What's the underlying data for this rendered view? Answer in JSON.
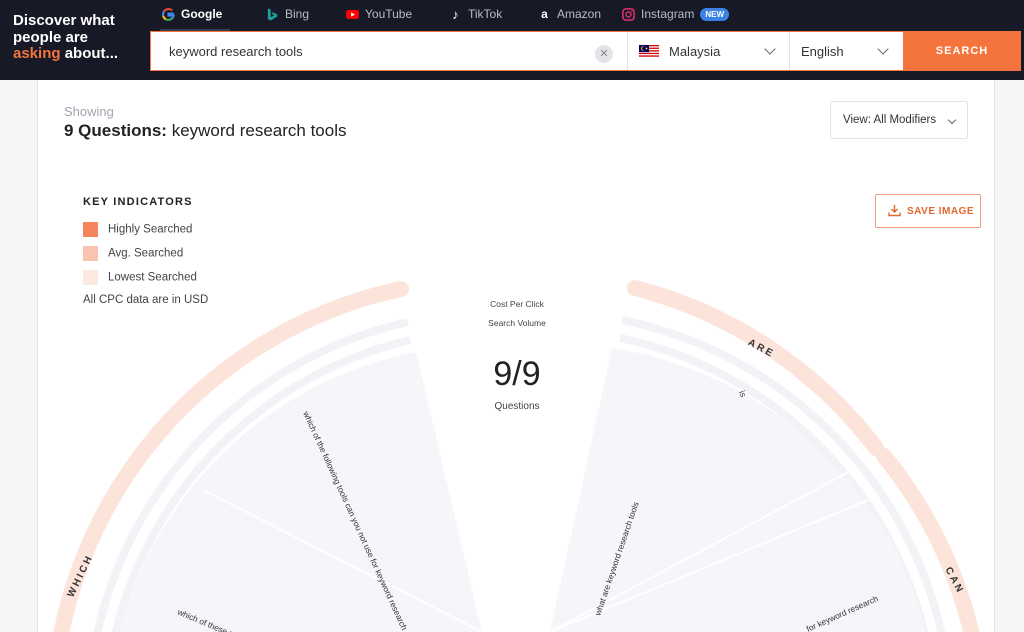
{
  "header": {
    "tagline_1": "Discover what",
    "tagline_2": "people are",
    "tagline_accent": "asking",
    "tagline_3": " about...",
    "engines": [
      {
        "label": "Google",
        "icon": "google-icon",
        "active": true
      },
      {
        "label": "Bing",
        "icon": "bing-icon"
      },
      {
        "label": "YouTube",
        "icon": "youtube-icon"
      },
      {
        "label": "TikTok",
        "icon": "tiktok-icon"
      },
      {
        "label": "Amazon",
        "icon": "amazon-icon"
      },
      {
        "label": "Instagram",
        "icon": "instagram-icon",
        "badge": "NEW"
      }
    ]
  },
  "search": {
    "value": "keyword research tools",
    "clear_icon": "close-icon",
    "country": "Malaysia",
    "country_icon": "malaysia-flag-icon",
    "language": "English",
    "button_label": "SEARCH"
  },
  "results": {
    "showing_label": "Showing",
    "count_label": "9 Questions:",
    "query": " keyword research tools",
    "view_label": "View: All Modifiers",
    "save_label": "SAVE IMAGE"
  },
  "legend": {
    "title": "KEY INDICATORS",
    "items": [
      {
        "label": "Highly Searched",
        "color": "#f5855c"
      },
      {
        "label": "Avg. Searched",
        "color": "#f8c4b0"
      },
      {
        "label": "Lowest Searched",
        "color": "#fce9e2"
      }
    ],
    "note": "All CPC data are in USD"
  },
  "wheel": {
    "cpc_label": "Cost Per Click",
    "volume_label": "Search Volume",
    "count": "9/9",
    "count_sub": "Questions",
    "modifiers": [
      "ARE",
      "CAN",
      "WHICH"
    ],
    "questions": [
      "which of the following tools can you not use for keyword research",
      "what are keyword research tools",
      "is",
      "which of these tools",
      "for keyword research"
    ],
    "ring_color": "#fce4da",
    "spoke_color": "#f4f6fa"
  },
  "colors": {
    "accent": "#f5743d",
    "header_bg": "#171a26"
  }
}
